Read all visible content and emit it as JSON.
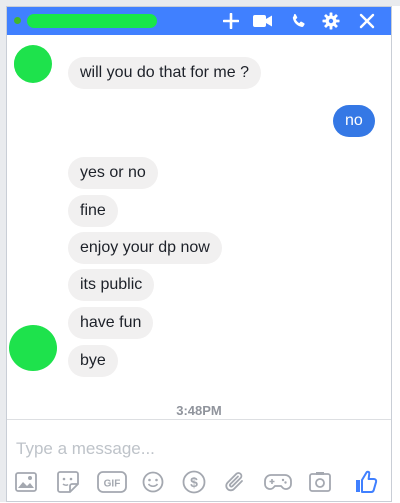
{
  "header": {
    "add_icon": "plus-icon",
    "video_icon": "video-camera-icon",
    "call_icon": "phone-icon",
    "settings_icon": "gear-icon",
    "close_icon": "close-icon",
    "accent_color": "#4080ff"
  },
  "messages": [
    {
      "direction": "in",
      "text": "will you do that for me ?"
    },
    {
      "direction": "out",
      "text": "no"
    },
    {
      "direction": "in",
      "text": "yes or no"
    },
    {
      "direction": "in",
      "text": "fine"
    },
    {
      "direction": "in",
      "text": "enjoy your dp now"
    },
    {
      "direction": "in",
      "text": "its public"
    },
    {
      "direction": "in",
      "text": "have fun"
    },
    {
      "direction": "in",
      "text": "bye"
    }
  ],
  "timestamp": "3:48PM",
  "composer": {
    "placeholder": "Type a message..."
  },
  "toolbar": {
    "gif_label": "GIF",
    "icons": [
      "image-icon",
      "sticker-icon",
      "gif-icon",
      "emoji-icon",
      "payment-icon",
      "attachment-icon",
      "game-controller-icon",
      "camera-icon",
      "thumbs-up-icon"
    ]
  }
}
